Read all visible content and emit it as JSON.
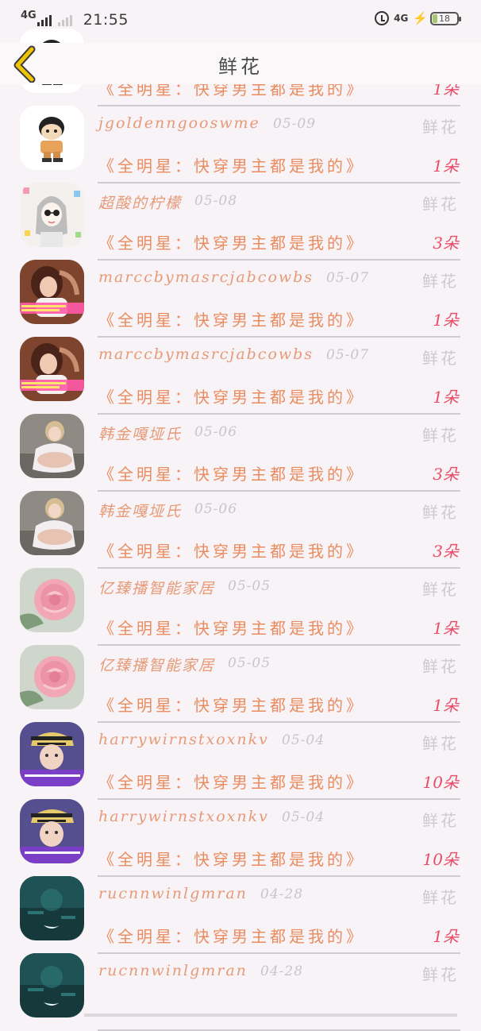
{
  "status_bar": {
    "network_left": "4G",
    "time": "21:55",
    "network_right": "4G",
    "battery_level": "18",
    "icons": [
      "signal-bars-icon",
      "alarm-clock-icon",
      "charging-bolt-icon",
      "battery-icon"
    ]
  },
  "header": {
    "title": "鲜花",
    "back_icon": "chevron-left-icon",
    "back_icon_color": "#f0c400"
  },
  "rows": [
    {
      "user": "",
      "date": "",
      "gift": "",
      "book": "《全明星：快穿男主都是我的》",
      "count": "1朵",
      "avatar": "cartoon-boy"
    },
    {
      "user": "jgoldenngooswme",
      "date": "05-09",
      "gift": "鲜花",
      "book": "《全明星：快穿男主都是我的》",
      "count": "1朵",
      "avatar": "cartoon-boy"
    },
    {
      "user": "超酸的柠檬",
      "date": "05-08",
      "gift": "鲜花",
      "book": "《全明星：快穿男主都是我的》",
      "count": "3朵",
      "avatar": "sketch-girl"
    },
    {
      "user": "marccbymasrcjabcowbs",
      "date": "05-07",
      "gift": "鲜花",
      "book": "《全明星：快穿男主都是我的》",
      "count": "1朵",
      "avatar": "photo-girl-pink"
    },
    {
      "user": "marccbymasrcjabcowbs",
      "date": "05-07",
      "gift": "鲜花",
      "book": "《全明星：快穿男主都是我的》",
      "count": "1朵",
      "avatar": "photo-girl-pink"
    },
    {
      "user": "韩金嘎垭氏",
      "date": "05-06",
      "gift": "鲜花",
      "book": "《全明星：快穿男主都是我的》",
      "count": "3朵",
      "avatar": "photo-girl-sitting"
    },
    {
      "user": "韩金嘎垭氏",
      "date": "05-06",
      "gift": "鲜花",
      "book": "《全明星：快穿男主都是我的》",
      "count": "3朵",
      "avatar": "photo-girl-sitting"
    },
    {
      "user": "亿臻播智能家居",
      "date": "05-05",
      "gift": "鲜花",
      "book": "《全明星：快穿男主都是我的》",
      "count": "1朵",
      "avatar": "pink-rose"
    },
    {
      "user": "亿臻播智能家居",
      "date": "05-05",
      "gift": "鲜花",
      "book": "《全明星：快穿男主都是我的》",
      "count": "1朵",
      "avatar": "pink-rose"
    },
    {
      "user": "harrywirnstxoxnkv",
      "date": "05-04",
      "gift": "鲜花",
      "book": "《全明星：快穿男主都是我的》",
      "count": "10朵",
      "avatar": "boy-cap"
    },
    {
      "user": "harrywirnstxoxnkv",
      "date": "05-04",
      "gift": "鲜花",
      "book": "《全明星：快穿男主都是我的》",
      "count": "10朵",
      "avatar": "boy-cap"
    },
    {
      "user": "rucnnwinlgmran",
      "date": "04-28",
      "gift": "鲜花",
      "book": "《全明星：快穿男主都是我的》",
      "count": "1朵",
      "avatar": "dark-scene"
    },
    {
      "user": "rucnnwinlgmran",
      "date": "04-28",
      "gift": "鲜花",
      "book": "",
      "count": "",
      "avatar": "dark-scene"
    }
  ],
  "colors": {
    "background": "#f7f3f6",
    "username": "#e79a78",
    "date": "#c9c4c7",
    "gift_type": "#cfc8cc",
    "book_title": "#ea8c5f",
    "count": "#ea4c67",
    "divider": "#cfcbce"
  }
}
